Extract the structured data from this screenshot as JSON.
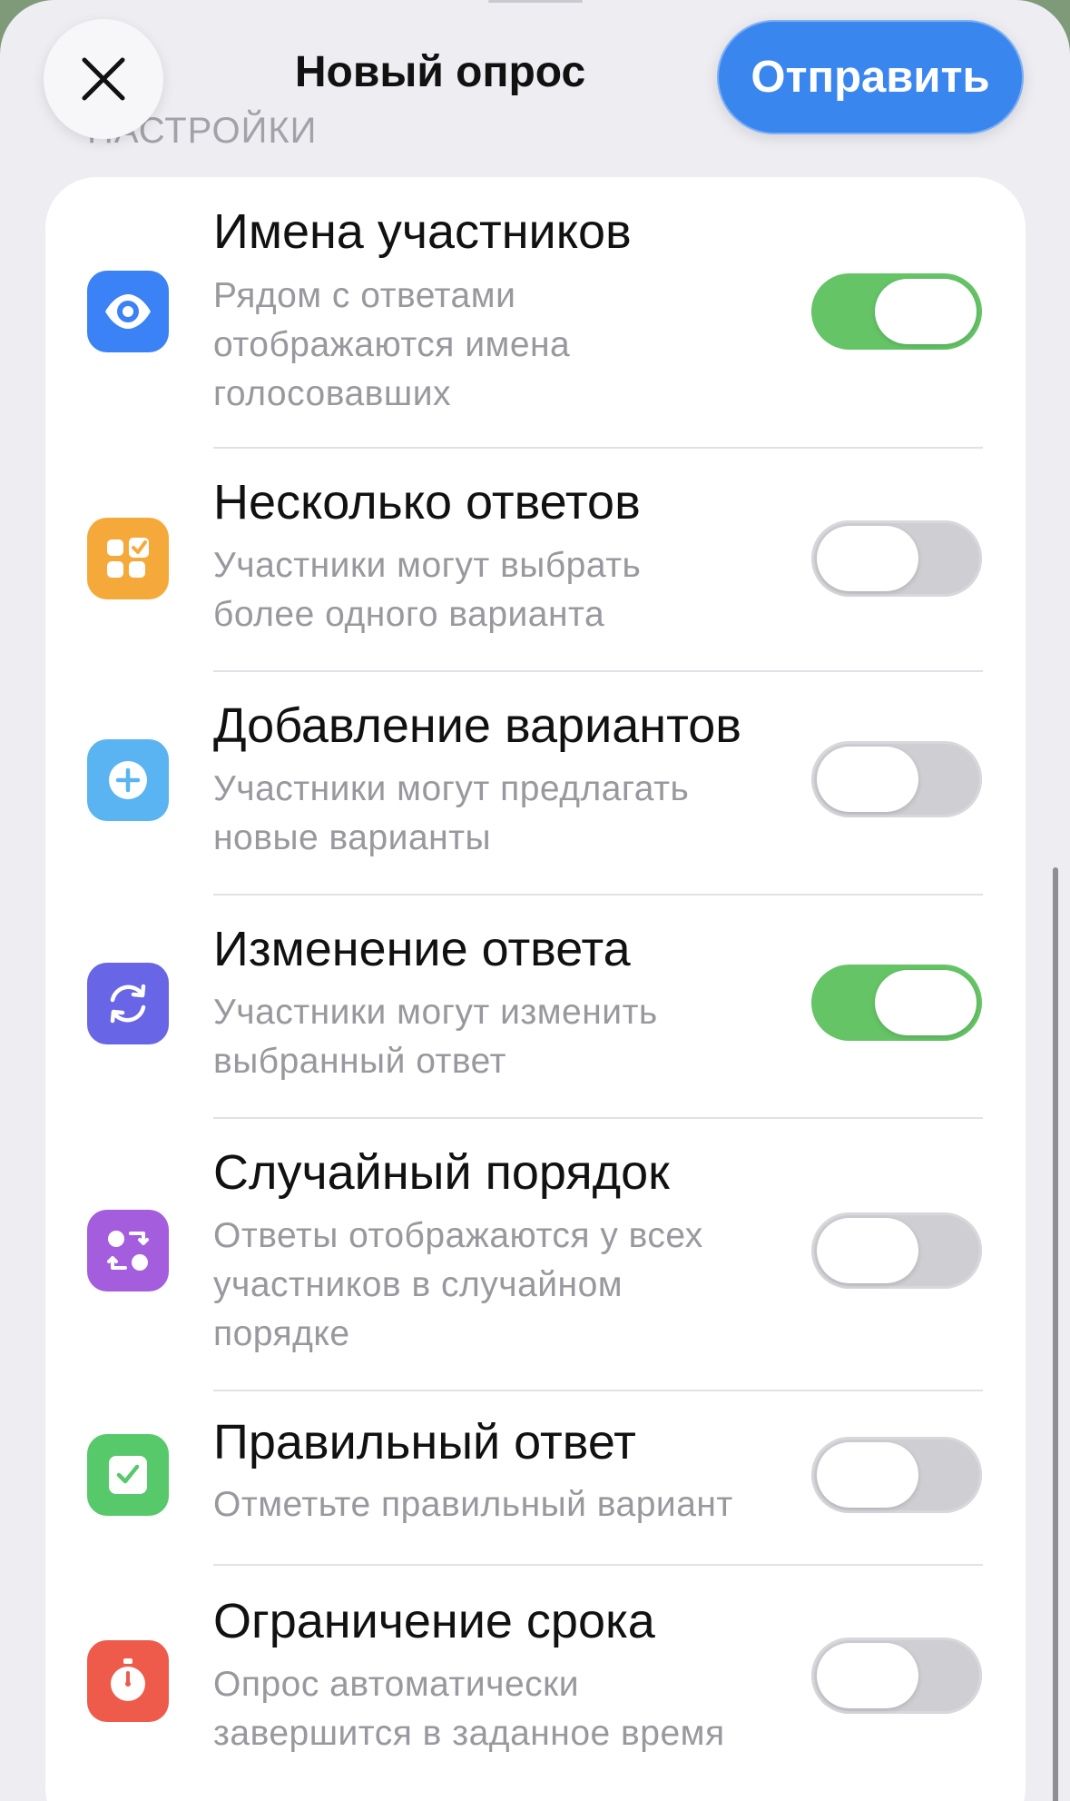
{
  "header": {
    "close_icon": "close-icon",
    "title": "Новый опрос",
    "send_label": "Отправить",
    "section_label": "НАСТРОЙКИ"
  },
  "colors": {
    "accent": "#3a86ef",
    "toggle_on": "#65c466",
    "toggle_off": "#cfcfd3"
  },
  "settings": [
    {
      "icon": "eye-icon",
      "icon_color": "#3b82f6",
      "title": "Имена участников",
      "subtitle_lines": [
        "Рядом с ответами",
        "отображаются имена",
        "голосовавших"
      ],
      "enabled": true
    },
    {
      "icon": "checklist-grid-icon",
      "icon_color": "#f6a93b",
      "title": "Несколько ответов",
      "subtitle_lines": [
        "Участники могут выбрать",
        "более одного варианта"
      ],
      "enabled": false
    },
    {
      "icon": "plus-circle-icon",
      "icon_color": "#5ab4f2",
      "title": "Добавление вариантов",
      "subtitle_lines": [
        "Участники могут предлагать",
        "новые варианты"
      ],
      "enabled": false
    },
    {
      "icon": "refresh-icon",
      "icon_color": "#6865e6",
      "title": "Изменение ответа",
      "subtitle_lines": [
        "Участники могут изменить",
        "выбранный ответ"
      ],
      "enabled": true
    },
    {
      "icon": "shuffle-icon",
      "icon_color": "#a45ddd",
      "title": "Случайный порядок",
      "subtitle_lines": [
        "Ответы отображаются у всех",
        "участников в случайном",
        "порядке"
      ],
      "enabled": false
    },
    {
      "icon": "checkmark-square-icon",
      "icon_color": "#58c96a",
      "title": "Правильный ответ",
      "subtitle_lines": [
        "Отметьте правильный вариант"
      ],
      "enabled": false
    },
    {
      "icon": "stopwatch-icon",
      "icon_color": "#ee5b4a",
      "title": "Ограничение срока",
      "subtitle_lines": [
        "Опрос автоматически",
        "завершится в заданное время"
      ],
      "enabled": false
    }
  ]
}
